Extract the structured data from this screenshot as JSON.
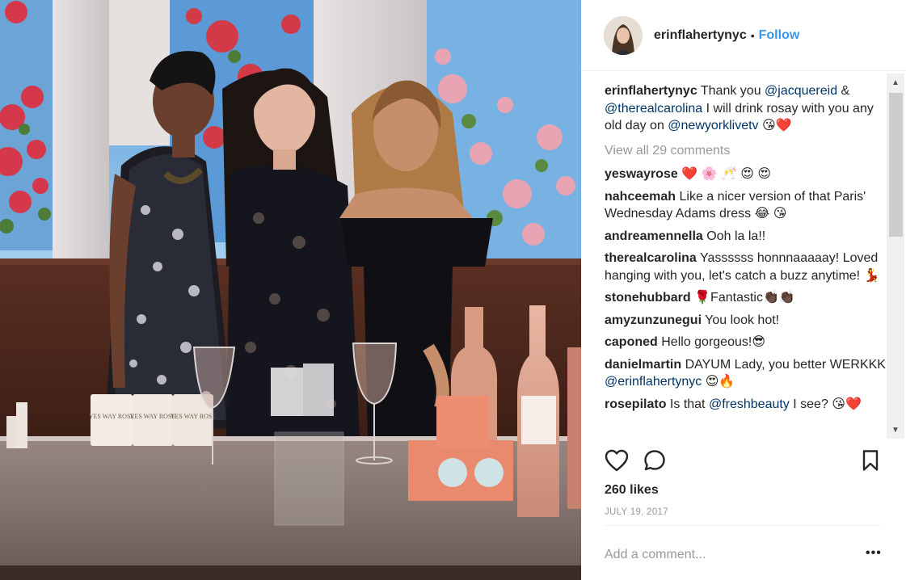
{
  "header": {
    "username": "erinflahertynyc",
    "dot": "•",
    "follow_label": "Follow"
  },
  "caption": {
    "user": "erinflahertynyc",
    "text1": "Thank you ",
    "m1": "@jacquereid",
    "text2": " & ",
    "m2": "@therealcarolina",
    "text3": " I will drink rosay with you any old day on ",
    "m3": "@newyorklivetv",
    "emoji": "😘❤️"
  },
  "view_all_label": "View all 29 comments",
  "comments": [
    {
      "user": "yeswayrose",
      "text": "❤️ 🌸 🥂 😍 😍"
    },
    {
      "user": "nahceemah",
      "text": "Like a nicer version of that Paris' Wednesday Adams dress 😂 😘"
    },
    {
      "user": "andreamennella",
      "text": "Ooh la la!!"
    },
    {
      "user": "therealcarolina",
      "text": "Yassssss honnnaaaaay! Loved hanging with you, let's catch a buzz anytime! 💃"
    },
    {
      "user": "stonehubbard",
      "text": "🌹Fantastic👏🏿👏🏿"
    },
    {
      "user": "amyzunzunegui",
      "text": "You look hot!"
    },
    {
      "user": "caponed",
      "text": "Hello gorgeous!😎"
    },
    {
      "user": "danielmartin",
      "text": "DAYUM Lady, you better WERKKK ",
      "mention": "@erinflahertynyc",
      "after": " 😍🔥"
    },
    {
      "user": "rosepilato",
      "text": "Is that ",
      "mention": "@freshbeauty",
      "after": " I see? 😘❤️"
    }
  ],
  "likes": "260 likes",
  "date": "JULY 19, 2017",
  "add_comment_placeholder": "Add a comment...",
  "more_label": "•••",
  "photo": {
    "candle_label": "YES WAY ROSE"
  },
  "colors": {
    "accent": "#3897f0",
    "mention": "#003569",
    "muted": "#999999",
    "text": "#262626"
  },
  "icons": {
    "like": "heart-icon",
    "comment": "speech-bubble-icon",
    "save": "bookmark-icon"
  }
}
